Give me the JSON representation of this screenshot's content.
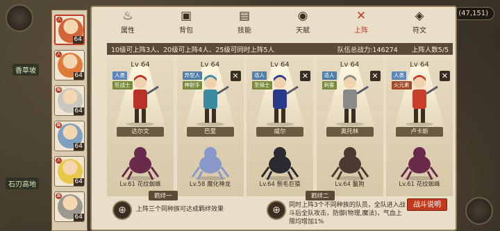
{
  "map": {
    "coords": "(47,151)",
    "labels": [
      "香草坡",
      "石刃高地"
    ]
  },
  "colors": {
    "accent": "#c13b24",
    "panel": "#e9dec7",
    "dark": "#3a2e22",
    "race_human": "#5c87b8",
    "race_alien": "#4f7ea8",
    "role_warrior": "#7a8a3c",
    "role_mage": "#a04a2a"
  },
  "tabs": [
    {
      "label": "属性",
      "icon": "flame-icon",
      "glyph": "♨"
    },
    {
      "label": "背包",
      "icon": "bag-icon",
      "glyph": "▣"
    },
    {
      "label": "技能",
      "icon": "book-icon",
      "glyph": "▤"
    },
    {
      "label": "天赋",
      "icon": "eye-icon",
      "glyph": "◉"
    },
    {
      "label": "上阵",
      "icon": "crossed-swords-icon",
      "glyph": "✕"
    },
    {
      "label": "符文",
      "icon": "rune-icon",
      "glyph": "◈"
    }
  ],
  "active_tab": "上阵",
  "info_bar": {
    "rule": "10级可上阵3人、20级可上阵4人、25级可同时上阵5人",
    "power": "队伍总战力:146274",
    "count": "上阵人数5/5"
  },
  "hero_strip": [
    {
      "level": "64",
      "race": "人",
      "color": "#d2643a",
      "selected": true
    },
    {
      "level": "64",
      "race": "人",
      "color": "#e07a3a",
      "selected": false
    },
    {
      "level": "64",
      "race": "兽",
      "color": "#c8c8c0",
      "selected": false
    },
    {
      "level": "64",
      "race": "兽",
      "color": "#7f9fc0",
      "selected": false
    },
    {
      "level": "64",
      "race": "人",
      "color": "#e8c84a",
      "selected": false
    },
    {
      "level": "64",
      "race": "兽",
      "color": "#9a9a90",
      "selected": false
    }
  ],
  "slots": [
    {
      "lv": "Lv 64",
      "race_tag": "人类",
      "role_tag": "狂战士",
      "name": "达尔文",
      "pet": "Lv.61 花纹蜘蛛",
      "hero_color": "#b8322a",
      "pet_color": "#6a2a4a",
      "removable": false
    },
    {
      "lv": "Lv 64",
      "race_tag": "异型人",
      "role_tag": "神射手",
      "name": "巴里",
      "pet": "Lv.58 魔化神龙",
      "hero_color": "#3a8aa0",
      "pet_color": "#8898c8",
      "removable": true
    },
    {
      "lv": "Lv 64",
      "race_tag": "适人",
      "role_tag": "圣骑士",
      "name": "威尔",
      "pet": "Lv.64 鬃毛巨猿",
      "hero_color": "#2a3a8a",
      "pet_color": "#2a2a30",
      "removable": true
    },
    {
      "lv": "Lv 64",
      "race_tag": "适人",
      "role_tag": "刺客",
      "name": "奥托林",
      "pet": "Lv.64 鬣狗",
      "hero_color": "#8a8a8a",
      "pet_color": "#4a3a30",
      "removable": true
    },
    {
      "lv": "Lv 64",
      "race_tag": "人类",
      "role_tag": "火元素",
      "name": "卢卡斯",
      "pet": "Lv.61 花纹蜘蛛",
      "hero_color": "#c8402a",
      "pet_color": "#6a2a4a",
      "removable": true
    }
  ],
  "bonds": [
    {
      "title": "羁绊一",
      "desc": "上阵三个同种族可达成羁绊效果",
      "icon": "crosshair-icon"
    },
    {
      "title": "羁绊二",
      "desc": "同时上阵3个不同种族的队员，全队进入战斗后全队攻击，防御(物理,魔法)，气血上限均增加1%",
      "icon": "crosshair-icon"
    }
  ],
  "battle_button": "战斗说明"
}
